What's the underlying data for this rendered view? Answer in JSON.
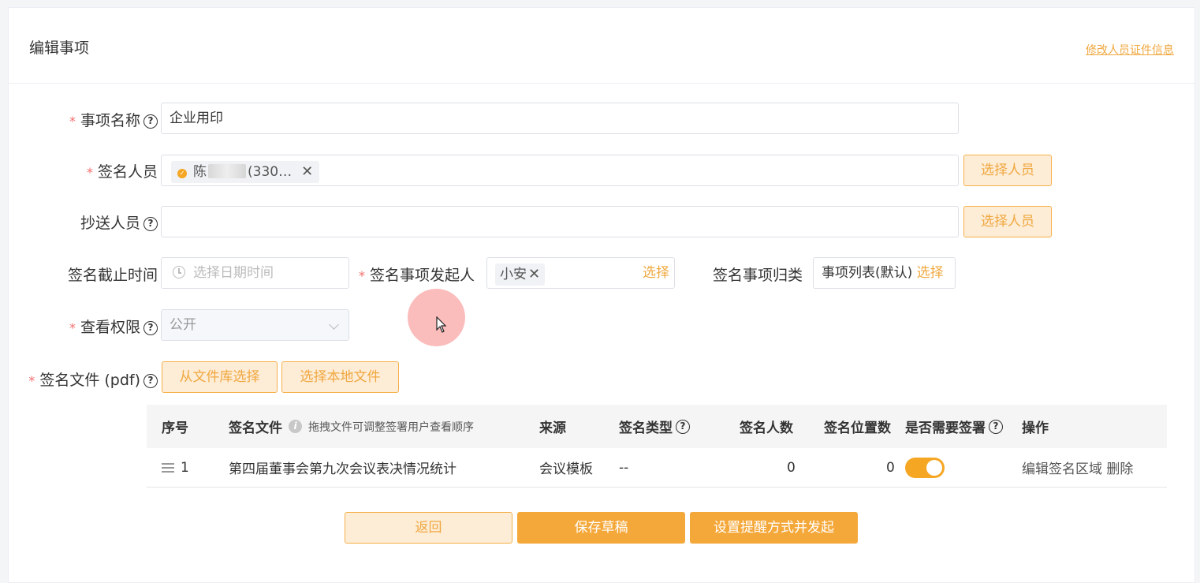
{
  "header": {
    "title": "编辑事项",
    "edit_link": "修改人员证件信息"
  },
  "form": {
    "item_name": {
      "label": "事项名称",
      "value": "企业用印"
    },
    "signers": {
      "label": "签名人员",
      "tag_prefix": "陈",
      "tag_suffix": "(330…",
      "select_btn": "选择人员"
    },
    "cc": {
      "label": "抄送人员",
      "value": "",
      "select_btn": "选择人员"
    },
    "deadline": {
      "label": "签名截止时间",
      "placeholder": "选择日期时间"
    },
    "initiator": {
      "label": "签名事项发起人",
      "tag": "小安",
      "select": "选择"
    },
    "category": {
      "label": "签名事项归类",
      "value": "事项列表(默认)",
      "select": "选择"
    },
    "permission": {
      "label": "查看权限",
      "value": "公开"
    },
    "files": {
      "label": "签名文件 (pdf)",
      "btn_library": "从文件库选择",
      "btn_local": "选择本地文件"
    }
  },
  "table": {
    "headers": {
      "index": "序号",
      "file": "签名文件",
      "file_hint": "拖拽文件可调整签署用户查看顺序",
      "source": "来源",
      "sign_type": "签名类型",
      "signer_count": "签名人数",
      "position_count": "签名位置数",
      "need_seal": "是否需要签署",
      "actions": "操作"
    },
    "rows": [
      {
        "index": "1",
        "file": "第四届董事会第九次会议表决情况统计",
        "source": "会议模板",
        "sign_type": "--",
        "signer_count": "0",
        "position_count": "0",
        "need_seal": true,
        "action_edit": "编辑签名区域",
        "action_delete": "删除"
      }
    ]
  },
  "footer": {
    "back": "返回",
    "save_draft": "保存草稿",
    "submit": "设置提醒方式并发起"
  },
  "colors": {
    "accent": "#f5a83a",
    "required": "#f56c6c"
  }
}
